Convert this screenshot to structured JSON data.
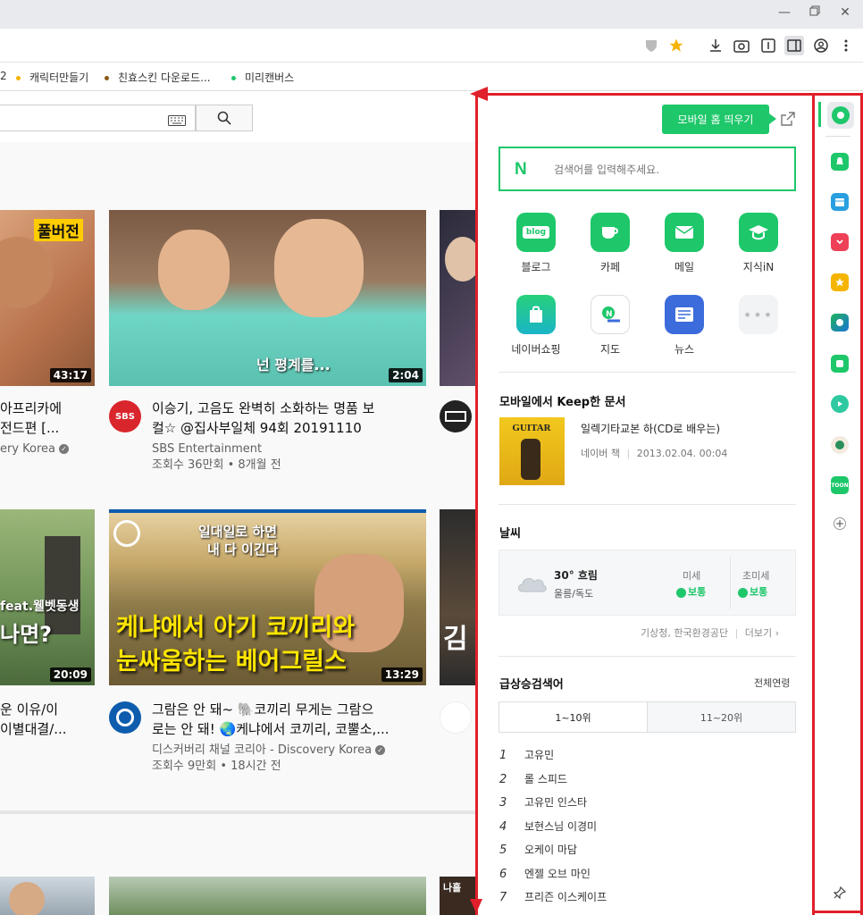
{
  "bookmarks": [
    {
      "label": "2",
      "color": "#f4b400"
    },
    {
      "label": "캐릭터만들기",
      "color": "#f4b400"
    },
    {
      "label": "친효스킨 다운로드...",
      "color": "#8a5a14"
    },
    {
      "label": "미리캔버스",
      "color": "#1ec76a"
    }
  ],
  "youtube": {
    "videos": [
      {
        "duration": "43:17",
        "title1": "아프리카에",
        "title2": "전드편 [...",
        "meta1": "ery Korea"
      },
      {
        "duration": "2:04",
        "overlay": "넌 평계를...",
        "title1": "이승기, 고음도 완벽히 소화하는 명품 보",
        "title2": "컬☆ @집사부일체 94회 20191110",
        "channel": "SBS Entertainment",
        "meta": "조회수 36만회 • 8개월 전",
        "avatar_text": "SBS"
      },
      {
        "duration": "20:09",
        "overlay1": "feat.웰벳동생",
        "overlay2": "나면?",
        "title1": "운 이유/이",
        "title2": "이별대결/..."
      },
      {
        "duration": "13:29",
        "overlay_top1": "일대일로 하면",
        "overlay_top2": "내 다 이긴다",
        "overlay1": "케냐에서 아기 코끼리와",
        "overlay2": "눈싸움하는 베어그릴스",
        "title1": "그람은 안 돼~ 🐘코끼리 무게는 그람으",
        "title2": "로는 안 돼! 🌏케냐에서 코끼리, 코뿔소,...",
        "channel": "디스커버리 채널 코리아 - Discovery Korea",
        "meta": "조회수 9만회 • 18시간 전"
      }
    ]
  },
  "panel": {
    "mobile_home": "모바일 홈 띄우기",
    "search_placeholder": "검색어를 입력해주세요.",
    "services": [
      {
        "label": "블로그",
        "icon": "blog",
        "color": "#1ec76a"
      },
      {
        "label": "카페",
        "icon": "cafe",
        "color": "#1ec76a"
      },
      {
        "label": "메일",
        "icon": "mail",
        "color": "#1ec76a"
      },
      {
        "label": "지식iN",
        "icon": "kin",
        "color": "#1ec76a"
      },
      {
        "label": "네이버쇼핑",
        "icon": "shopping",
        "color": "#1ec76a"
      },
      {
        "label": "지도",
        "icon": "map",
        "color": "#ffffff"
      },
      {
        "label": "뉴스",
        "icon": "news",
        "color": "#3c6bdb"
      }
    ],
    "keep": {
      "title": "모바일에서 Keep한 문서",
      "doc_title": "일렉기타교본 하(CD로 배우는)",
      "doc_source": "네이버 책",
      "doc_date": "2013.02.04. 00:04",
      "thumb_text": "GUITAR"
    },
    "weather": {
      "title": "날씨",
      "temp": "30° 흐림",
      "location": "울릉/독도",
      "dust_label": "미세",
      "dust_value": "보통",
      "fine_dust_label": "초미세",
      "fine_dust_value": "보통",
      "source": "기상청, 한국환경공단",
      "more": "더보기"
    },
    "trending": {
      "title": "급상승검색어",
      "all_link": "전체연령",
      "tab1": "1~10위",
      "tab2": "11~20위",
      "items": [
        "고유민",
        "롤 스피드",
        "고유민 인스타",
        "보현스님 이경미",
        "오케이 마담",
        "엔젤 오브 마인",
        "프리즌 이스케이프"
      ]
    }
  },
  "sidebar_icons": [
    "naver-icon",
    "alarm-icon",
    "calendar-icon",
    "pocket-icon",
    "bookmark-star-icon",
    "edge-icon",
    "green-app-icon",
    "play-icon",
    "avatar-app-icon",
    "webtoon-icon",
    "add-icon",
    "pin-icon"
  ],
  "colors": {
    "naver_green": "#1ec76a",
    "annotation_red": "#e0202a"
  }
}
